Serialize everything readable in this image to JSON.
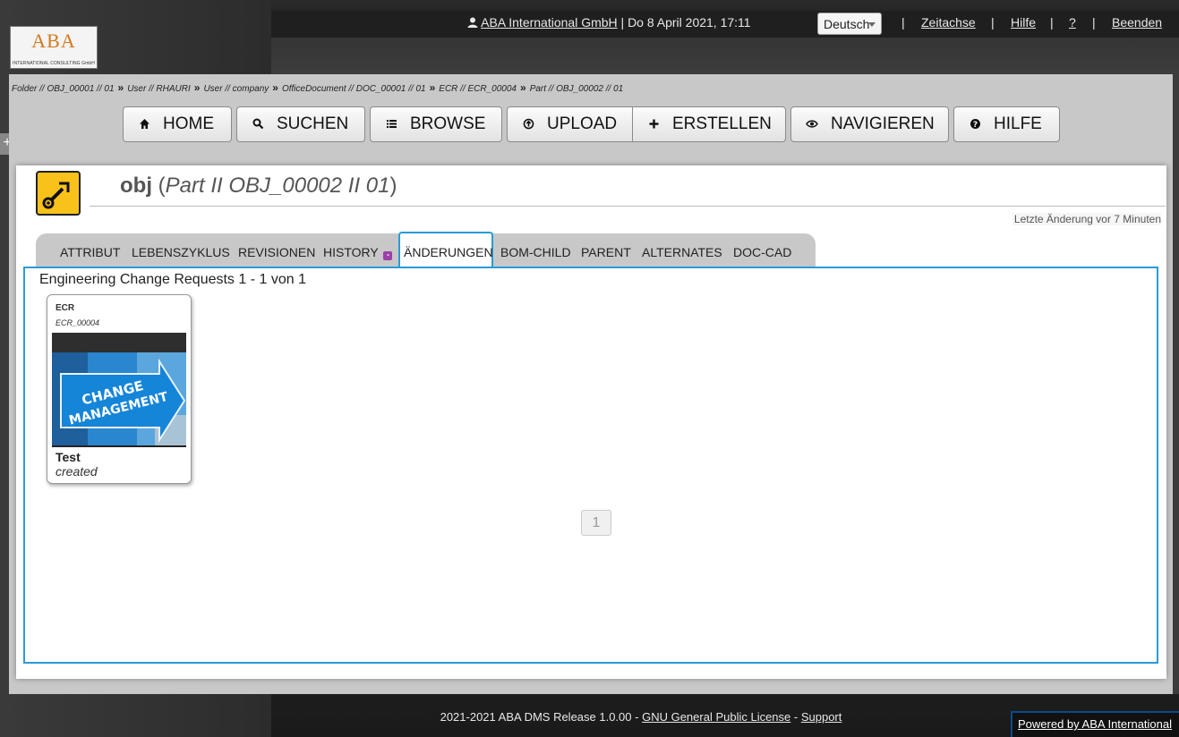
{
  "logo": {
    "text": "ABA",
    "subtext": "INTERNATIONAL CONSULTING GmbH"
  },
  "header": {
    "user_company": "ABA International GmbH",
    "datetime": " | Do 8 April 2021, 17:11",
    "language": "Deutsch",
    "links": [
      "Zeitachse",
      "Hilfe",
      "?",
      "Beenden"
    ]
  },
  "breadcrumb": [
    "Folder // OBJ_00001 // 01",
    "User // RHAURI",
    "User // company",
    "OfficeDocument // DOC_00001 // 01",
    "ECR // ECR_00004",
    "Part // OBJ_00002 // 01"
  ],
  "nav": {
    "home": "HOME",
    "search": "SUCHEN",
    "browse": "BROWSE",
    "upload": "UPLOAD",
    "create": "ERSTELLEN",
    "navigate": "NAVIGIEREN",
    "help": "HILFE"
  },
  "object": {
    "name": "obj",
    "detail": "Part II OBJ_00002 II  01",
    "last_change": "Letzte Änderung vor 7 Minuten"
  },
  "tabs": [
    "ATTRIBUT",
    "LEBENSZYKLUS",
    "REVISIONEN",
    "HISTORY",
    "ÄNDERUNGEN",
    "BOM-CHILD",
    "PARENT",
    "ALTERNATES",
    "DOC-CAD"
  ],
  "active_tab": "ÄNDERUNGEN",
  "changes": {
    "heading": "Engineering Change Requests 1 - 1 von 1",
    "cards": [
      {
        "type": "ECR",
        "id": "ECR_00004",
        "image_text": [
          "CHANGE",
          "MANAGEMENT"
        ],
        "title": "Test",
        "status": "created"
      }
    ],
    "page": "1"
  },
  "footer": {
    "release": "2021-2021 ABA DMS Release 1.0.00 - ",
    "license": "GNU General Public License",
    "dash": " - ",
    "support": "Support",
    "powered": "Powered by ABA International"
  },
  "colors": {
    "accent": "#2a9bd6",
    "logo_orange": "#d27a1e",
    "object_icon": "#f8c21a"
  }
}
